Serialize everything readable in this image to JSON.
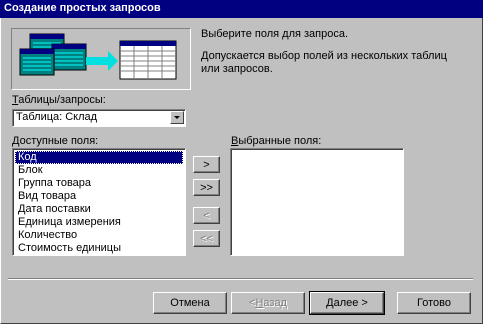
{
  "window": {
    "title": "Создание простых запросов"
  },
  "intro": {
    "line1": "Выберите поля для запроса.",
    "line2": "Допускается выбор полей из нескольких таблиц",
    "line3": "или запросов."
  },
  "tables": {
    "label_accel": "Т",
    "label_rest": "аблицы/запросы:",
    "selected": "Таблица: Склад"
  },
  "available": {
    "label_accel": "Д",
    "label_rest": "оступные поля:",
    "items": [
      "Код",
      "Блок",
      "Группа товара",
      "Вид товара",
      "Дата поставки",
      "Единица измерения",
      "Количество",
      "Стоимость единицы"
    ],
    "selected_index": 0
  },
  "chosen": {
    "label_accel": "В",
    "label_rest": "ыбранные поля:",
    "items": []
  },
  "move": {
    "add_one": ">",
    "add_all": ">>",
    "remove_one": "<",
    "remove_all": "<<"
  },
  "footer": {
    "cancel": "Отмена",
    "back_prefix": "< ",
    "back_accel": "Н",
    "back_rest": "азад",
    "next": "Далее >",
    "finish": "Готово"
  },
  "colors": {
    "title_bg": "#000080",
    "face": "#c0c0c0",
    "selection": "#000080",
    "arrow": "#00e0e0"
  }
}
